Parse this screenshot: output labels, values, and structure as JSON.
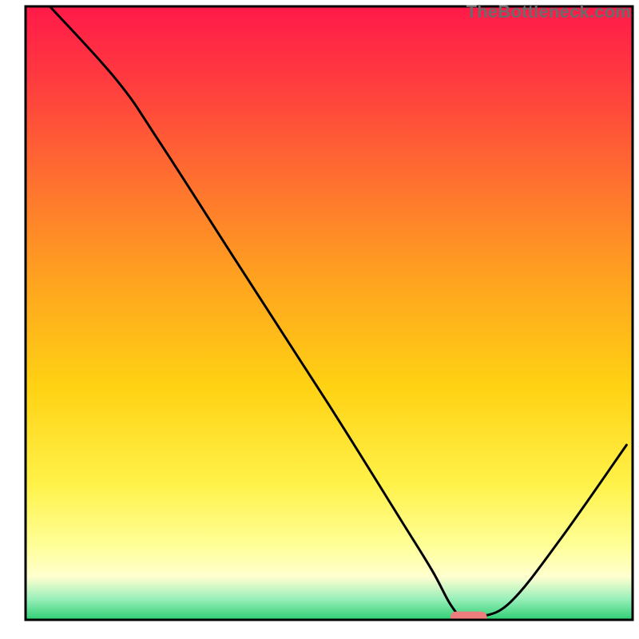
{
  "watermark": "TheBottleneck.com",
  "chart_data": {
    "type": "line",
    "title": "",
    "xlabel": "",
    "ylabel": "",
    "xlim": [
      0,
      100
    ],
    "ylim": [
      0,
      100
    ],
    "grid": false,
    "legend": false,
    "background_gradient": {
      "stops": [
        {
          "offset": 0.0,
          "color": "#ff1a49"
        },
        {
          "offset": 0.12,
          "color": "#ff3b3f"
        },
        {
          "offset": 0.28,
          "color": "#ff6f30"
        },
        {
          "offset": 0.45,
          "color": "#ffa41f"
        },
        {
          "offset": 0.62,
          "color": "#ffd213"
        },
        {
          "offset": 0.78,
          "color": "#fff24a"
        },
        {
          "offset": 0.88,
          "color": "#ffff99"
        },
        {
          "offset": 0.93,
          "color": "#ffffd0"
        },
        {
          "offset": 0.965,
          "color": "#9cf0bb"
        },
        {
          "offset": 1.0,
          "color": "#2ecf74"
        }
      ]
    },
    "axis_box": {
      "x0": 4,
      "y0": 3,
      "x1": 99,
      "y1": 99
    },
    "curve": {
      "x": [
        4,
        15,
        22,
        35,
        50,
        62,
        67,
        70,
        72,
        75,
        80,
        88,
        99
      ],
      "y": [
        100,
        88,
        78,
        58,
        35,
        16,
        8,
        2.5,
        0.5,
        0.5,
        3,
        13,
        28.5
      ]
    },
    "plateau_marker": {
      "x_start": 70,
      "x_end": 76,
      "y": 0,
      "color": "#ef7d7d",
      "thickness": 2.6
    }
  }
}
